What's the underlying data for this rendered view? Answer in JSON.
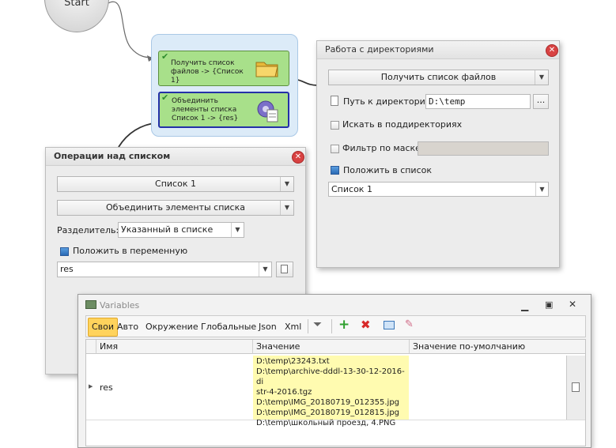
{
  "flow": {
    "start_label": "Start",
    "node1_text": "Получить список файлов -> {Список 1}",
    "node2_text": "Объединить элементы списка Список 1 -> {res}"
  },
  "dir_panel": {
    "title": "Работа с директориями",
    "action": "Получить список файлов",
    "path_label": "Путь к директории",
    "path_value": "D:\\temp",
    "browse_label": "...",
    "subdirs_label": "Искать в поддиректориях",
    "mask_label": "Фильтр по маске",
    "put_label": "Положить в список",
    "list_value": "Список 1"
  },
  "list_panel": {
    "title": "Операции над списком",
    "list_value": "Список 1",
    "operation": "Объединить элементы списка",
    "separator_label": "Разделитель:",
    "separator_value": "Указанный в списке",
    "put_var_label": "Положить в переменную",
    "var_value": "res"
  },
  "variables": {
    "title": "Variables",
    "tabs": [
      "Свои",
      "Авто",
      "Окружение",
      "Глобальные",
      "Json",
      "Xml"
    ],
    "columns": [
      "Имя",
      "Значение",
      "Значение по-умолчанию"
    ],
    "row_name": "res",
    "row_value_lines": [
      "D:\\temp\\23243.txt",
      "D:\\temp\\archive-dddl-13-30-12-2016-di",
      "str-4-2016.tgz",
      "D:\\temp\\IMG_20180719_012355.jpg",
      "D:\\temp\\IMG_20180719_012815.jpg",
      "D:\\temp\\школьный проезд, 4.PNG"
    ],
    "row_default": ""
  },
  "colors": {
    "node_green": "#a8e08a",
    "value_highlight": "#fffbb0",
    "active_tab": "#ffd35c"
  }
}
